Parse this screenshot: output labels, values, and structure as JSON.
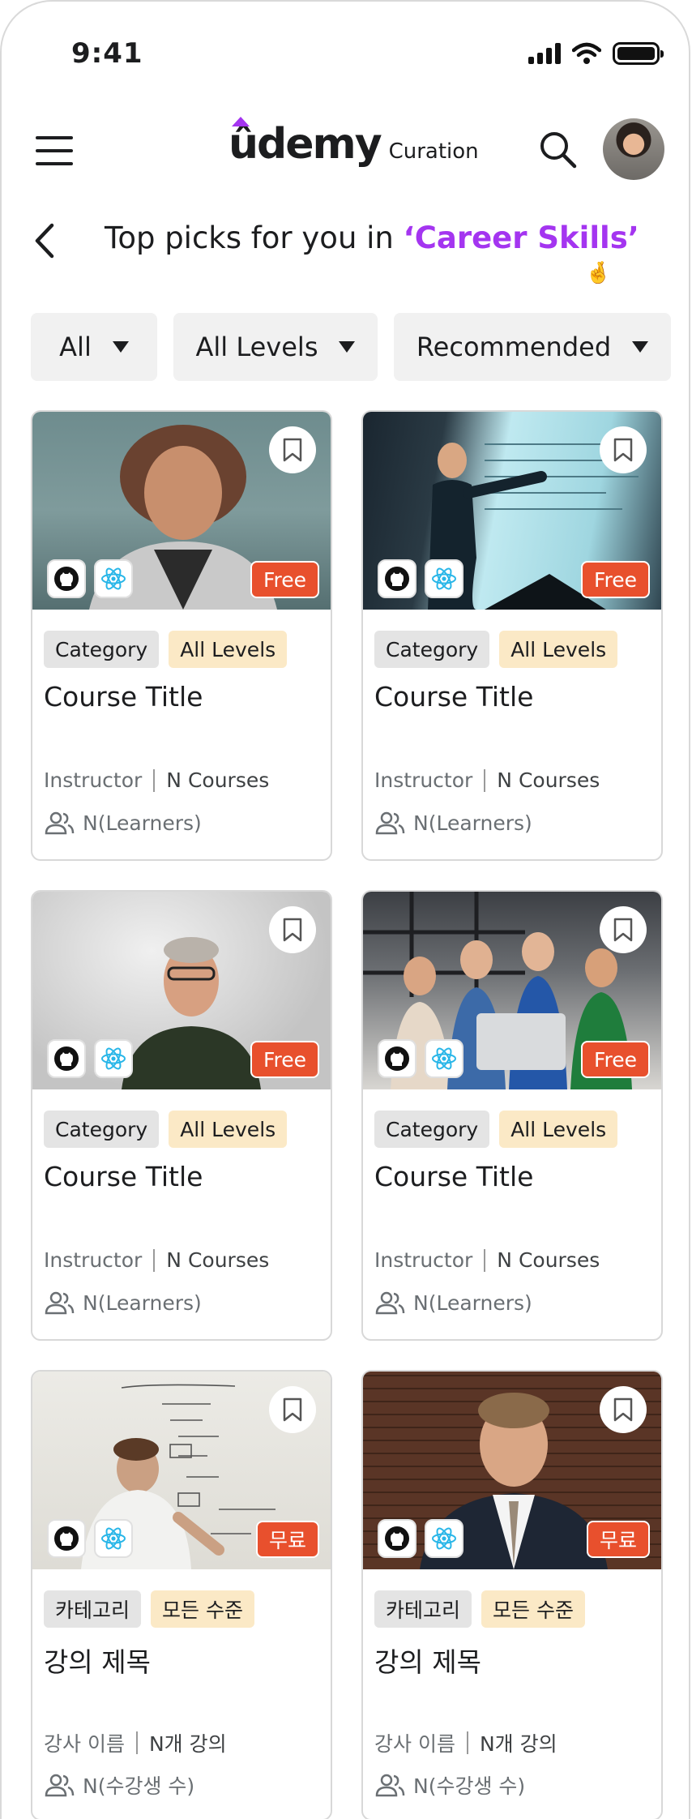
{
  "status_bar": {
    "time": "9:41"
  },
  "header": {
    "logo_text": "ûdemy",
    "logo_sub": "Curation"
  },
  "page": {
    "title_prefix": "Top picks for you in ",
    "title_highlight": "‘Career Skills’",
    "emoji": "🤞"
  },
  "filters": [
    {
      "label": "All"
    },
    {
      "label": "All Levels"
    },
    {
      "label": "Recommended"
    }
  ],
  "cards": [
    {
      "category": "Category",
      "level": "All Levels",
      "title": "Course Title",
      "instructor": "Instructor",
      "courses": "N Courses",
      "learners": "N(Learners)",
      "price_badge": "Free"
    },
    {
      "category": "Category",
      "level": "All Levels",
      "title": "Course Title",
      "instructor": "Instructor",
      "courses": "N Courses",
      "learners": "N(Learners)",
      "price_badge": "Free"
    },
    {
      "category": "Category",
      "level": "All Levels",
      "title": "Course Title",
      "instructor": "Instructor",
      "courses": "N Courses",
      "learners": "N(Learners)",
      "price_badge": "Free"
    },
    {
      "category": "Category",
      "level": "All Levels",
      "title": "Course Title",
      "instructor": "Instructor",
      "courses": "N Courses",
      "learners": "N(Learners)",
      "price_badge": "Free"
    },
    {
      "category": "카테고리",
      "level": "모든 수준",
      "title": "강의 제목",
      "instructor": "강사 이름",
      "courses": "N개 강의",
      "learners": "N(수강생 수)",
      "price_badge": "무료"
    },
    {
      "category": "카테고리",
      "level": "모든 수준",
      "title": "강의 제목",
      "instructor": "강사 이름",
      "courses": "N개 강의",
      "learners": "N(수강생 수)",
      "price_badge": "무료"
    }
  ],
  "colors": {
    "accent": "#a435f0",
    "free_badge": "#e8502d",
    "level_tag": "#fbe9c6",
    "category_tag": "#e4e4e4"
  }
}
